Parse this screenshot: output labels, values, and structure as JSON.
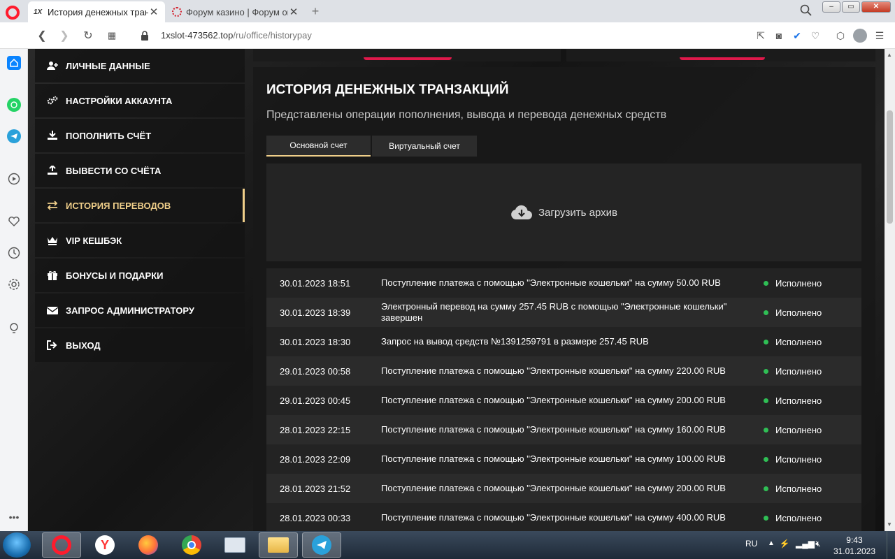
{
  "browser": {
    "tabs": [
      {
        "title": "История денежных транза",
        "favicon": "1X"
      },
      {
        "title": "Форум казино | Форум он"
      }
    ],
    "url_host": "1xslot-473562.top",
    "url_path": "/ru/office/historypay",
    "colors": {
      "opera_red": "#ff1b2d",
      "accent_gold": "#f0cf8a",
      "status_green": "#2fbf55"
    }
  },
  "menu": {
    "items": [
      {
        "label": "ЛИЧНЫЕ ДАННЫЕ",
        "icon": "user-add-icon"
      },
      {
        "label": "НАСТРОЙКИ АККАУНТА",
        "icon": "gears-icon"
      },
      {
        "label": "ПОПОЛНИТЬ СЧЁТ",
        "icon": "download-icon"
      },
      {
        "label": "ВЫВЕСТИ СО СЧЁТА",
        "icon": "upload-icon"
      },
      {
        "label": "ИСТОРИЯ ПЕРЕВОДОВ",
        "icon": "transfer-arrows-icon",
        "active": true
      },
      {
        "label": "VIP КЕШБЭК",
        "icon": "crown-icon"
      },
      {
        "label": "БОНУСЫ И ПОДАРКИ",
        "icon": "gift-icon"
      },
      {
        "label": "ЗАПРОС АДМИНИСТРАТОРУ",
        "icon": "envelope-icon"
      },
      {
        "label": "ВЫХОД",
        "icon": "logout-icon"
      }
    ]
  },
  "history": {
    "title": "ИСТОРИЯ ДЕНЕЖНЫХ ТРАНЗАКЦИЙ",
    "subtitle": "Представлены операции пополнения, вывода и перевода денежных средств",
    "tabs": [
      "Основной счет",
      "Виртуальный счет"
    ],
    "active_tab": "Основной счет",
    "archive_label": "Загрузить архив",
    "rows": [
      {
        "date": "30.01.2023 18:51",
        "desc": "Поступление платежа с помощью \"Электронные кошельки\" на сумму 50.00 RUB",
        "status": "Исполнено"
      },
      {
        "date": "30.01.2023 18:39",
        "desc": "Электронный перевод на сумму 257.45 RUB с помощью \"Электронные кошельки\" завершен",
        "status": "Исполнено"
      },
      {
        "date": "30.01.2023 18:30",
        "desc": "Запрос на вывод средств №1391259791 в размере 257.45 RUB",
        "status": "Исполнено"
      },
      {
        "date": "29.01.2023 00:58",
        "desc": "Поступление платежа с помощью \"Электронные кошельки\" на сумму 220.00 RUB",
        "status": "Исполнено"
      },
      {
        "date": "29.01.2023 00:45",
        "desc": "Поступление платежа с помощью \"Электронные кошельки\" на сумму 200.00 RUB",
        "status": "Исполнено"
      },
      {
        "date": "28.01.2023 22:15",
        "desc": "Поступление платежа с помощью \"Электронные кошельки\" на сумму 160.00 RUB",
        "status": "Исполнено"
      },
      {
        "date": "28.01.2023 22:09",
        "desc": "Поступление платежа с помощью \"Электронные кошельки\" на сумму 100.00 RUB",
        "status": "Исполнено"
      },
      {
        "date": "28.01.2023 21:52",
        "desc": "Поступление платежа с помощью \"Электронные кошельки\" на сумму 200.00 RUB",
        "status": "Исполнено"
      },
      {
        "date": "28.01.2023 00:33",
        "desc": "Поступление платежа с помощью \"Электронные кошельки\" на сумму 400.00 RUB",
        "status": "Исполнено"
      }
    ]
  },
  "taskbar": {
    "lang": "RU",
    "time": "9:43",
    "date": "31.01.2023",
    "apps": [
      "opera",
      "yandex-browser",
      "firefox",
      "chrome",
      "keyboard",
      "file-explorer",
      "telegram"
    ]
  }
}
